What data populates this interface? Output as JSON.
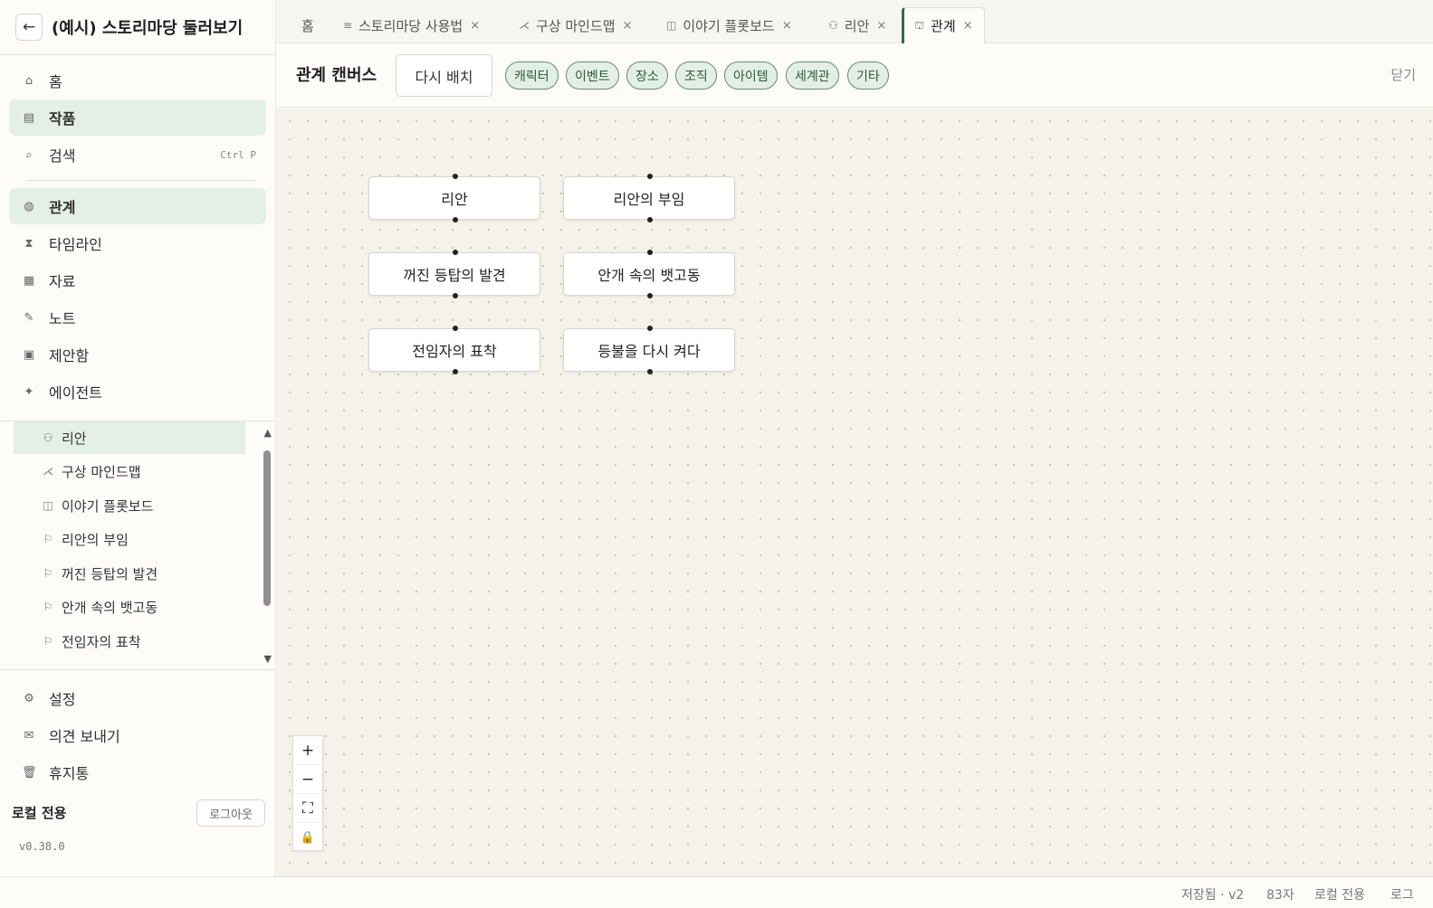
{
  "sidebar": {
    "back_icon": "arrow-left-icon",
    "title": "(예시) 스토리마당 둘러보기",
    "nav": [
      {
        "icon": "⌂",
        "icon_name": "home-icon",
        "label": "홈"
      },
      {
        "icon": "▤",
        "icon_name": "works-icon",
        "label": "작품"
      },
      {
        "icon": "⌕",
        "icon_name": "search-icon",
        "label": "검색",
        "shortcut": "Ctrl P"
      },
      {
        "icon": "◍",
        "icon_name": "relations-icon",
        "label": "관계"
      },
      {
        "icon": "⧗",
        "icon_name": "timeline-icon",
        "label": "타임라인"
      },
      {
        "icon": "▦",
        "icon_name": "materials-icon",
        "label": "자료"
      },
      {
        "icon": "✎",
        "icon_name": "note-icon",
        "label": "노트"
      },
      {
        "icon": "▣",
        "icon_name": "suggestion-box-icon",
        "label": "제안함"
      },
      {
        "icon": "✦",
        "icon_name": "agent-icon",
        "label": "에이전트"
      }
    ],
    "tree": [
      {
        "icon": "⚇",
        "label": "리안"
      },
      {
        "icon": "⋌",
        "label": "구상 마인드맵"
      },
      {
        "icon": "◫",
        "label": "이야기 플롯보드"
      },
      {
        "icon": "⚐",
        "label": "리안의 부임"
      },
      {
        "icon": "⚐",
        "label": "꺼진 등탑의 발견"
      },
      {
        "icon": "⚐",
        "label": "안개 속의 뱃고동"
      },
      {
        "icon": "⚐",
        "label": "전임자의 표착"
      }
    ],
    "bottom": [
      {
        "icon": "⚙",
        "icon_name": "settings-icon",
        "label": "설정"
      },
      {
        "icon": "✉",
        "icon_name": "mail-icon",
        "label": "의견 보내기"
      },
      {
        "icon": "🗑",
        "icon_name": "trash-icon",
        "label": "휴지통"
      }
    ],
    "local_label": "로컬 전용",
    "logout_label": "로그아웃",
    "version": "v0.38.0"
  },
  "tabs": [
    {
      "label": "홈",
      "icon": ""
    },
    {
      "label": "스토리마당 사용법",
      "icon": "≡",
      "close": "×"
    },
    {
      "label": "구상 마인드맵",
      "icon": "⋌",
      "close": "×"
    },
    {
      "label": "이야기 플롯보드",
      "icon": "◫",
      "close": "×"
    },
    {
      "label": "리안",
      "icon": "⚇",
      "close": "×"
    },
    {
      "label": "관계",
      "icon": "⛫",
      "close": "×"
    }
  ],
  "toolbar": {
    "title": "관계 캔버스",
    "relayout_label": "다시 배치",
    "chips": [
      "캐릭터",
      "이벤트",
      "장소",
      "조직",
      "아이템",
      "세계관",
      "기타"
    ],
    "close_label": "닫기",
    "accent": "#2f6b4a"
  },
  "canvas": {
    "nodes": [
      "리안",
      "리안의 부임",
      "꺼진 등탑의 발견",
      "안개 속의 뱃고동",
      "전임자의 표착",
      "등불을 다시 켜다"
    ],
    "zoom_controls": [
      {
        "glyph": "+",
        "name": "zoom-in-icon"
      },
      {
        "glyph": "−",
        "name": "zoom-out-icon"
      },
      {
        "glyph": "⛶",
        "name": "fit-view-icon"
      },
      {
        "glyph": "🔒",
        "name": "lock-icon"
      }
    ]
  },
  "status": {
    "saved": "저장됨 · v2",
    "chars": "83자",
    "mode": "로컬 전용",
    "log": "로그"
  }
}
